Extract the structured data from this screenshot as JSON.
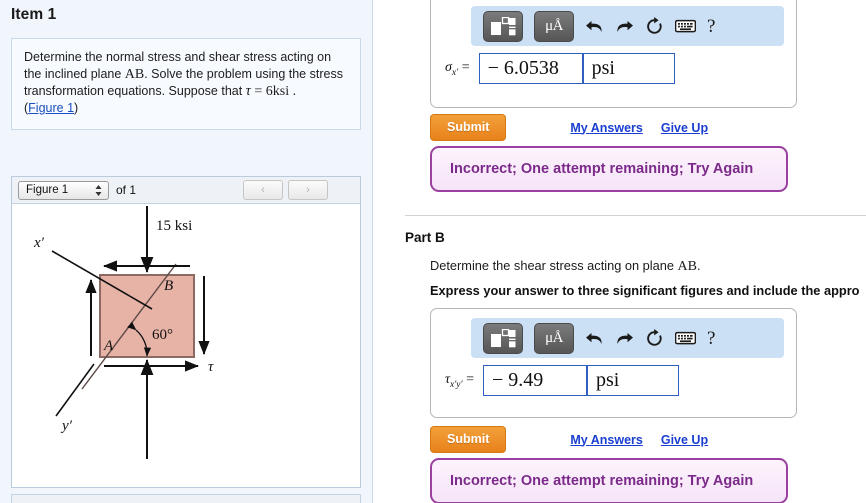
{
  "left": {
    "item_title": "Item 1",
    "problem": {
      "line1_a": "Determine the normal stress and shear stress acting on",
      "line2_a": "the inclined plane ",
      "line2_math": "AB",
      "line2_b": ". Solve the problem using the",
      "line3_a": "stress transformation equations. Suppose that ",
      "line3_tau": "τ",
      "line3_b": " = 6ksi .",
      "figure_link": "Figure 1",
      "paren_open": "(",
      "paren_close": ")"
    },
    "figure_bar": {
      "select_value": "Figure 1",
      "of_label": "of 1",
      "prev_icon": "‹",
      "next_icon": "›",
      "spinner_icon": "⇅"
    },
    "figure": {
      "load_label": "15 ksi",
      "point_a": "A",
      "point_b": "B",
      "angle_label": "60°",
      "axis_x": "x′",
      "axis_y": "y′",
      "shear_label": "τ",
      "fill_color": "#e7b3a6",
      "stroke_color": "#8a6a62"
    }
  },
  "right": {
    "part_a": {
      "toolbar": {
        "template_icon": "template-icon",
        "units_icon": "μÅ",
        "undo_icon": "undo-icon",
        "redo_icon": "redo-icon",
        "reset_icon": "reset-icon",
        "keyboard_icon": "keyboard-icon",
        "help_icon": "?"
      },
      "answer_label_base": "σ",
      "answer_label_sub": "x′",
      "equals": "=",
      "value": "− 6.0538",
      "unit": "psi",
      "submit_label": "Submit",
      "my_answers_label": "My Answers",
      "give_up_label": "Give Up",
      "feedback": "Incorrect; One attempt remaining; Try Again"
    },
    "part_b": {
      "heading": "Part B",
      "prompt_a": "Determine the shear stress acting on plane ",
      "prompt_math": "AB",
      "prompt_b": ".",
      "instruction": "Express your answer to three significant figures and include the appro",
      "toolbar": {
        "template_icon": "template-icon",
        "units_icon": "μÅ",
        "undo_icon": "undo-icon",
        "redo_icon": "redo-icon",
        "reset_icon": "reset-icon",
        "keyboard_icon": "keyboard-icon",
        "help_icon": "?"
      },
      "answer_label_base": "τ",
      "answer_label_sub": "x′y′",
      "equals": "=",
      "value": "− 9.49",
      "unit": "psi",
      "submit_label": "Submit",
      "my_answers_label": "My Answers",
      "give_up_label": "Give Up",
      "feedback": "Incorrect; One attempt remaining; Try Again"
    }
  },
  "colors": {
    "accent_orange": "#e8821b",
    "link_blue": "#1a3fd0",
    "feedback_purple": "#7b2a8a",
    "toolbar_blue": "#cbe0f5",
    "field_border": "#2f5fbf",
    "panel_bg": "#f1f6fc"
  }
}
